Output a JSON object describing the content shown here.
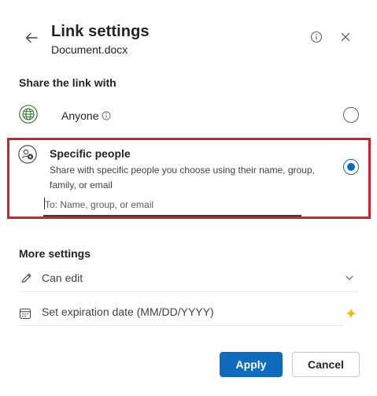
{
  "header": {
    "title": "Link settings",
    "subtitle": "Document.docx",
    "back_icon": "arrow-left-icon",
    "info_icon": "info-icon",
    "close_icon": "close-icon"
  },
  "share_section": {
    "label": "Share the link with",
    "options": [
      {
        "label": "Anyone",
        "icon": "globe-icon",
        "info_icon": "info-icon",
        "selected": false
      },
      {
        "label": "Specific people",
        "icon": "people-icon",
        "description": "Share with specific people you choose using their name, group, family, or email",
        "selected": true,
        "input_placeholder": "To: Name, group, or email",
        "input_value": ""
      }
    ]
  },
  "more_settings": {
    "label": "More settings",
    "permission": {
      "label": "Can edit",
      "icon": "pencil-icon",
      "dropdown_icon": "chevron-down-icon"
    },
    "expiration": {
      "placeholder": "Set expiration date (MM/DD/YYYY)",
      "icon": "calendar-icon",
      "action_icon": "sparkle-icon"
    }
  },
  "footer": {
    "apply_label": "Apply",
    "cancel_label": "Cancel"
  },
  "colors": {
    "accent": "#0f6cbd",
    "highlight": "#d1202f"
  }
}
